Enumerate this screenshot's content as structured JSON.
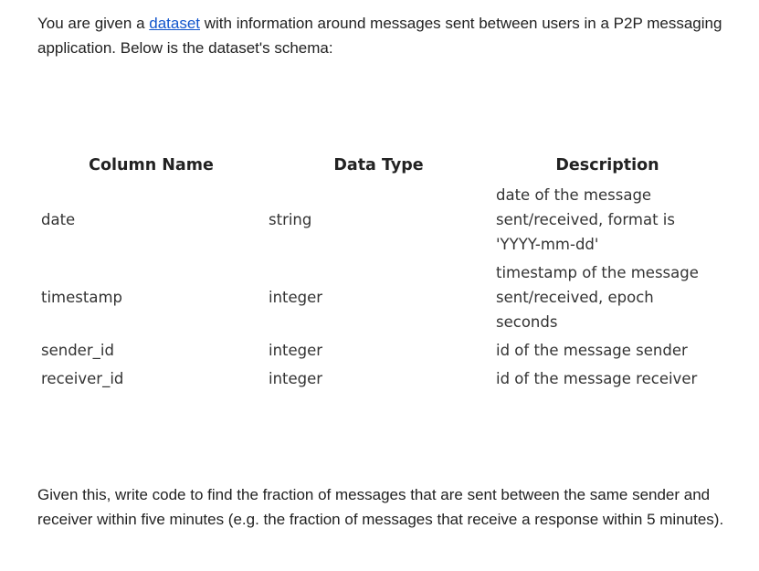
{
  "intro": {
    "before_link": "You are given a ",
    "link_text": "dataset",
    "after_link": " with information around messages sent between users in a P2P messaging application. Below is the dataset's schema:"
  },
  "schema": {
    "headers": [
      "Column Name",
      "Data Type",
      "Description"
    ],
    "rows": [
      {
        "name": "date",
        "type": "string",
        "description": "date of the message sent/received, format is 'YYYY-mm-dd'"
      },
      {
        "name": "timestamp",
        "type": "integer",
        "description": "timestamp of the message sent/received, epoch seconds"
      },
      {
        "name": "sender_id",
        "type": "integer",
        "description": "id of the message sender"
      },
      {
        "name": "receiver_id",
        "type": "integer",
        "description": "id of the message receiver"
      }
    ]
  },
  "footer": {
    "text": "Given this, write code to find the fraction of messages that are sent between the same sender and receiver within five minutes (e.g. the fraction of messages that receive a response within 5 minutes)."
  },
  "colors": {
    "link": "#1155cc",
    "text": "#222222"
  }
}
